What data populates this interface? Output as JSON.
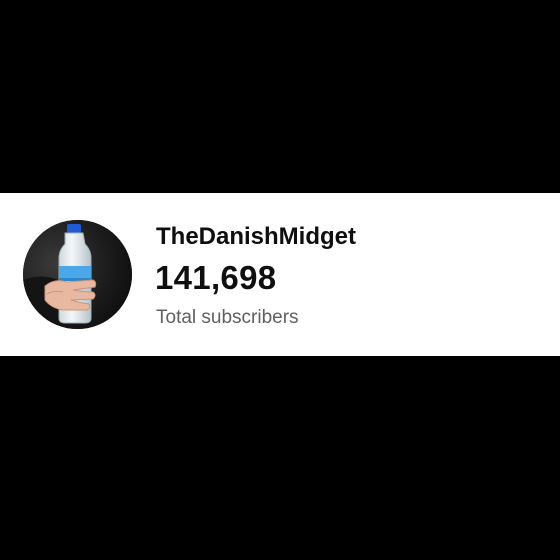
{
  "channel": {
    "name": "TheDanishMidget",
    "subscriber_count": "141,698",
    "subscriber_label": "Total subscribers",
    "avatar_icon": "water-bottle-in-hand-avatar"
  },
  "colors": {
    "background": "#000000",
    "card": "#ffffff",
    "primary_text": "#0f0f0f",
    "secondary_text": "#606060",
    "bottle_cap": "#1f5bd6",
    "bottle_label": "#4aa8e8"
  }
}
